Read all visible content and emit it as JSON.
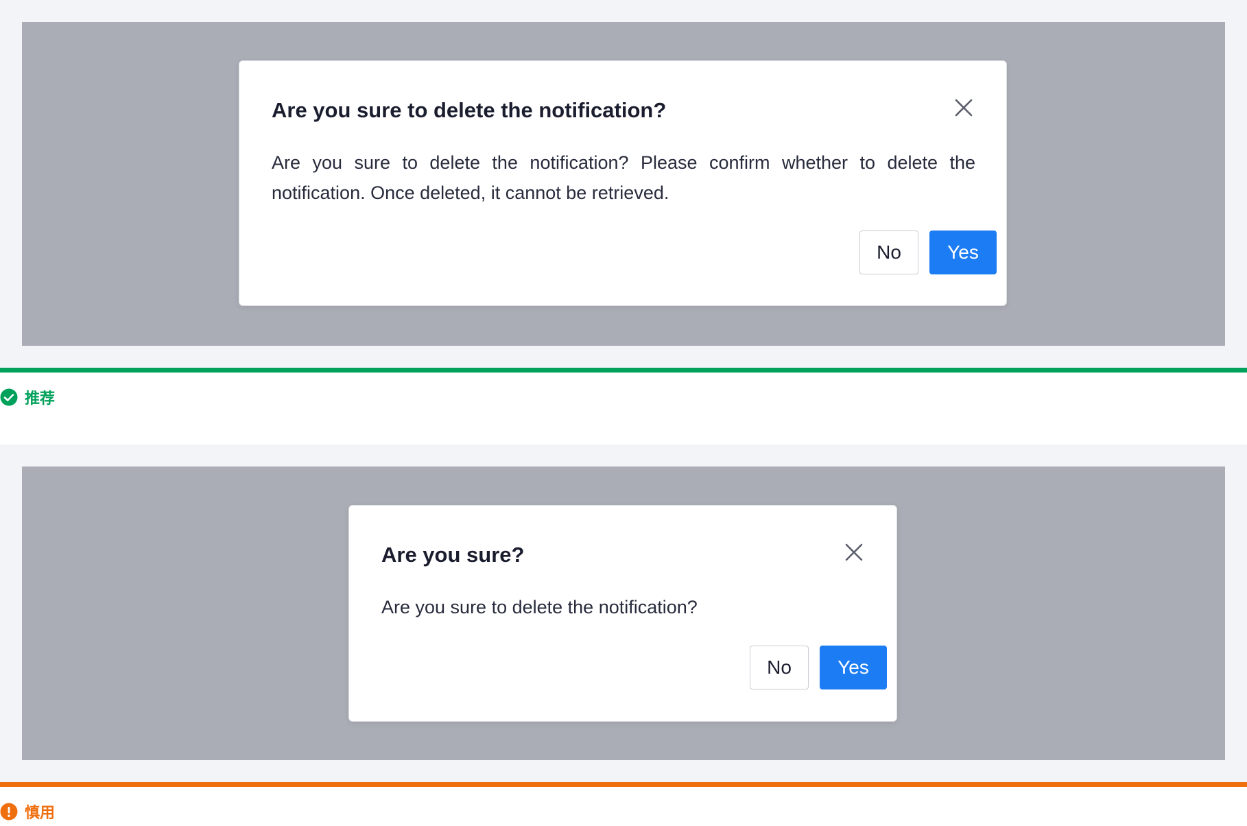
{
  "examples": [
    {
      "dialog": {
        "title": "Are you sure to delete the notification?",
        "body": "Are you sure to delete the notification? Please confirm whether to delete the notification. Once deleted, it cannot be retrieved.",
        "no_label": "No",
        "yes_label": "Yes",
        "close_icon": "close-icon"
      },
      "verdict": {
        "label": "推荐",
        "icon": "check-circle-icon",
        "color": "#00a15a"
      }
    },
    {
      "dialog": {
        "title": "Are you sure?",
        "body": "Are you sure to delete the notification?",
        "no_label": "No",
        "yes_label": "Yes",
        "close_icon": "close-icon"
      },
      "verdict": {
        "label": "慎用",
        "icon": "exclamation-circle-icon",
        "color": "#ef6f0f"
      }
    }
  ],
  "colors": {
    "primary_button": "#1c7cf3",
    "overlay": "#aaadb5",
    "recommend": "#00a15a",
    "caution": "#ef6f0f"
  }
}
